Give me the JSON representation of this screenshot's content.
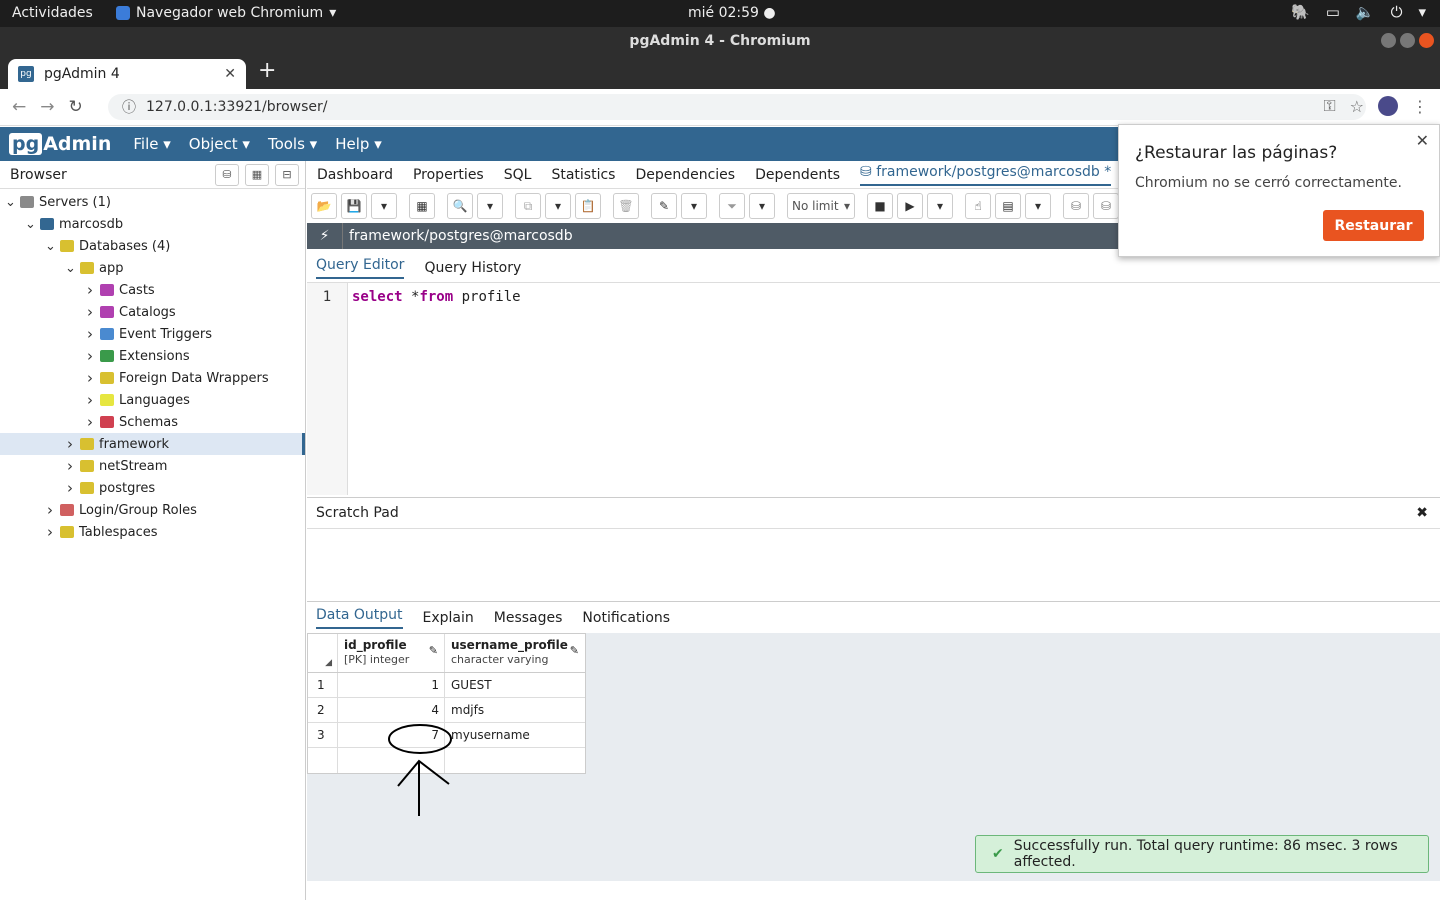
{
  "system": {
    "activities": "Actividades",
    "app_name": "Navegador web Chromium",
    "clock": "mié 02:59"
  },
  "window": {
    "title": "pgAdmin 4 - Chromium"
  },
  "browser": {
    "tab_title": "pgAdmin 4",
    "url": "127.0.0.1:33921/browser/"
  },
  "pgadmin": {
    "logo_pg": "pg",
    "logo_admin": "Admin",
    "menu": [
      "File",
      "Object",
      "Tools",
      "Help"
    ]
  },
  "sidebar": {
    "title": "Browser",
    "tree": [
      {
        "label": "Servers (1)",
        "level": 0,
        "expanded": true,
        "color": "#8a8a8a"
      },
      {
        "label": "marcosdb",
        "level": 1,
        "expanded": true,
        "color": "#336791"
      },
      {
        "label": "Databases (4)",
        "level": 2,
        "expanded": true,
        "color": "#d8c030"
      },
      {
        "label": "app",
        "level": 3,
        "expanded": true,
        "color": "#d8c030"
      },
      {
        "label": "Casts",
        "level": 4,
        "expanded": false,
        "color": "#b040b0"
      },
      {
        "label": "Catalogs",
        "level": 4,
        "expanded": false,
        "color": "#b040b0"
      },
      {
        "label": "Event Triggers",
        "level": 4,
        "expanded": false,
        "color": "#4a8ad0"
      },
      {
        "label": "Extensions",
        "level": 4,
        "expanded": false,
        "color": "#3a9a4a"
      },
      {
        "label": "Foreign Data Wrappers",
        "level": 4,
        "expanded": false,
        "color": "#d8c030"
      },
      {
        "label": "Languages",
        "level": 4,
        "expanded": false,
        "color": "#e6e640"
      },
      {
        "label": "Schemas",
        "level": 4,
        "expanded": false,
        "color": "#d04050"
      },
      {
        "label": "framework",
        "level": 3,
        "expanded": false,
        "color": "#d8c030",
        "selected": true
      },
      {
        "label": "netStream",
        "level": 3,
        "expanded": false,
        "color": "#d8c030"
      },
      {
        "label": "postgres",
        "level": 3,
        "expanded": false,
        "color": "#d8c030"
      },
      {
        "label": "Login/Group Roles",
        "level": 2,
        "expanded": false,
        "color": "#d06060"
      },
      {
        "label": "Tablespaces",
        "level": 2,
        "expanded": false,
        "color": "#d8c030"
      }
    ]
  },
  "main_tabs": [
    "Dashboard",
    "Properties",
    "SQL",
    "Statistics",
    "Dependencies",
    "Dependents"
  ],
  "query_tab_label": "framework/postgres@marcosdb *",
  "toolbar": {
    "limit": "No limit"
  },
  "connection": {
    "label": "framework/postgres@marcosdb"
  },
  "query_tabs": [
    "Query Editor",
    "Query History"
  ],
  "editor": {
    "line_number": "1",
    "code_kw1": "select",
    "code_mid": " *",
    "code_kw2": "from",
    "code_end": " profile"
  },
  "scratch_pad": {
    "title": "Scratch Pad"
  },
  "output_tabs": [
    "Data Output",
    "Explain",
    "Messages",
    "Notifications"
  ],
  "result": {
    "columns": [
      {
        "name": "id_profile",
        "type": "[PK] integer"
      },
      {
        "name": "username_profile",
        "type": "character varying"
      }
    ],
    "rows": [
      {
        "n": "1",
        "id": "1",
        "user": "GUEST"
      },
      {
        "n": "2",
        "id": "4",
        "user": "mdjfs"
      },
      {
        "n": "3",
        "id": "7",
        "user": "myusername"
      }
    ]
  },
  "toast": {
    "message": "Successfully run. Total query runtime: 86 msec. 3 rows affected."
  },
  "restore_popup": {
    "title": "¿Restaurar las páginas?",
    "body": "Chromium no se cerró correctamente.",
    "button": "Restaurar"
  },
  "colors": {
    "pgadmin_blue": "#326690",
    "ubuntu_orange": "#e95420",
    "success_green": "#d5f0d9"
  }
}
